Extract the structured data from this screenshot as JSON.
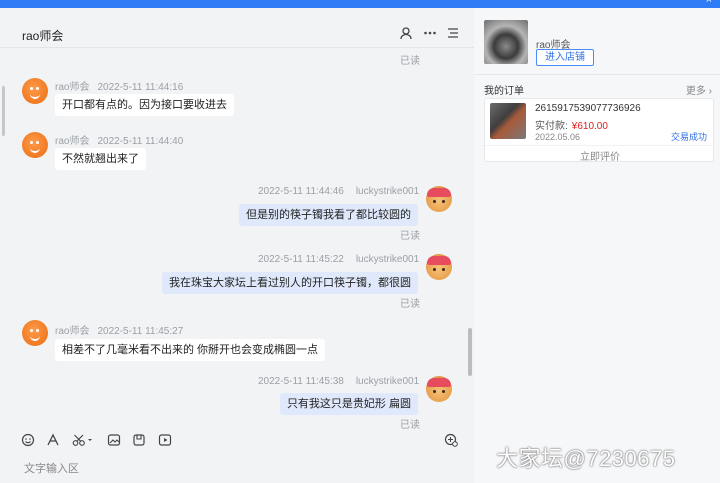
{
  "window": {
    "top_text": "",
    "close_glyph": "×"
  },
  "chat": {
    "title": "rao师会",
    "header_icons": [
      "person-icon",
      "more-icon",
      "menu-icon"
    ],
    "read_label": "已读",
    "messages": [
      {
        "sender": "rao师会",
        "time": "2022-5-11 11:44:16",
        "text": "开口都有点的。因为接口要收进去"
      },
      {
        "sender": "rao师会",
        "time": "2022-5-11 11:44:40",
        "text": "不然就翘出来了"
      },
      {
        "sender": "luckystrike001",
        "time": "2022-5-11 11:44:46",
        "text": "但是别的筷子镯我看了都比较圆的",
        "status": "已读"
      },
      {
        "sender": "luckystrike001",
        "time": "2022-5-11 11:45:22",
        "text": "我在珠宝大家坛上看过别人的开口筷子镯，都很圆",
        "status": "已读"
      },
      {
        "sender": "rao师会",
        "time": "2022-5-11 11:45:27",
        "text": "相差不了几毫米看不出来的 你掰开也会变成椭圆一点"
      },
      {
        "sender": "luckystrike001",
        "time": "2022-5-11 11:45:38",
        "text": "只有我这只是贵妃形 扁圆",
        "status": "已读"
      }
    ]
  },
  "toolbar": {
    "icons": [
      "emoji-icon",
      "font-icon",
      "scissors-icon",
      "image-icon",
      "file-icon",
      "video-icon",
      "settings-icon"
    ],
    "input_placeholder": "文字输入区"
  },
  "sidebar": {
    "shop_name": "rao师会",
    "enter_shop_label": "进入店铺",
    "orders_title": "我的订单",
    "orders_more": "更多 ›",
    "order": {
      "id": "2615917539077736926",
      "paid_label": "实付款:",
      "price": "¥610.00",
      "date": "2022.05.06",
      "status": "交易成功",
      "review_label": "立即评价"
    }
  },
  "watermark": "大家坛@7230675"
}
